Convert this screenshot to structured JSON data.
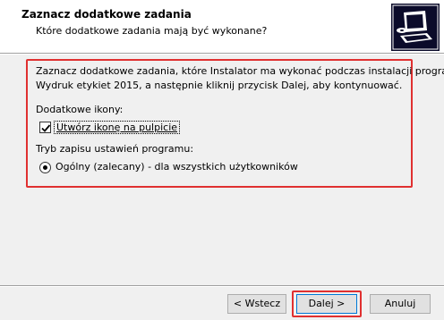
{
  "header": {
    "title": "Zaznacz dodatkowe zadania",
    "subtitle": "Które dodatkowe zadania mają być wykonane?",
    "icon": "installer-computer-icon"
  },
  "body": {
    "intro_line1": "Zaznacz dodatkowe zadania, które Instalator ma wykonać podczas instalacji programu",
    "intro_line2": "Wydruk etykiet 2015, a następnie kliknij przycisk Dalej, aby kontynuować.",
    "icons_group_label": "Dodatkowe ikony:",
    "desktop_icon_checkbox": {
      "label": "Utwórz ikonę na pulpicie",
      "checked": true
    },
    "settings_group_label": "Tryb zapisu ustawień programu:",
    "settings_radio": {
      "label": "Ogólny (zalecany) - dla wszystkich użytkowników",
      "selected": true
    }
  },
  "footer": {
    "back_label": "< Wstecz",
    "next_label": "Dalej >",
    "cancel_label": "Anuluj"
  },
  "colors": {
    "highlight": "#e03030",
    "header_bg": "#ffffff",
    "body_bg": "#f0f0f0",
    "default_button_border": "#0078d7"
  }
}
